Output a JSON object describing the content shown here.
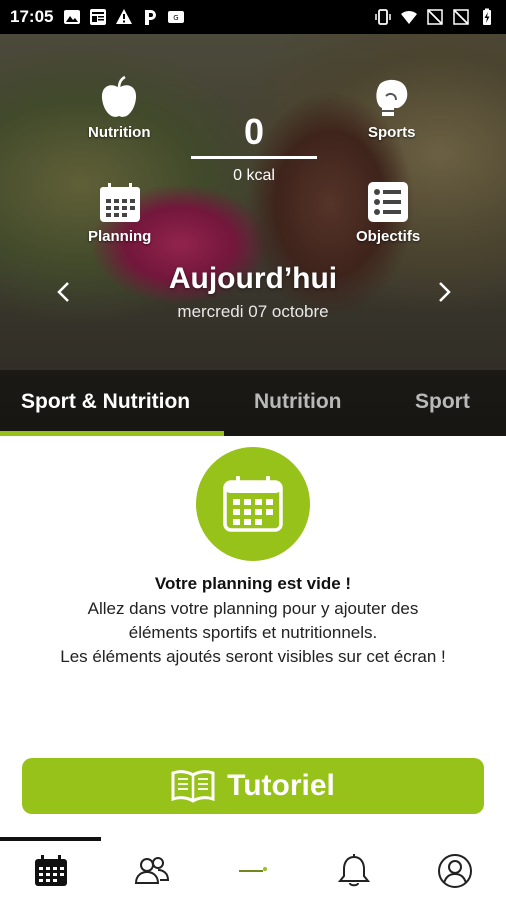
{
  "status_bar": {
    "time": "17:05",
    "left_icons": [
      "photo-icon",
      "news-icon",
      "warning-icon",
      "parking-icon",
      "message-icon"
    ],
    "right_icons": [
      "vibrate-icon",
      "wifi-icon",
      "signal-off-icon",
      "signal-off-icon",
      "battery-charging-icon"
    ]
  },
  "hero": {
    "nutrition_label": "Nutrition",
    "sports_label": "Sports",
    "planning_label": "Planning",
    "objectives_label": "Objectifs",
    "calories_value": "0",
    "calories_unit": "0 kcal",
    "date_title": "Aujourd’hui",
    "date_subtitle": "mercredi 07 octobre"
  },
  "tabs": [
    {
      "label": "Sport & Nutrition",
      "active": true
    },
    {
      "label": "Nutrition",
      "active": false
    },
    {
      "label": "Sport",
      "active": false
    }
  ],
  "empty_state": {
    "title": "Votre planning est vide !",
    "line1": "Allez dans votre planning pour y ajouter des",
    "line2": "éléments sportifs et nutritionnels.",
    "line3": "Les éléments ajoutés seront visibles sur cet écran !"
  },
  "tutorial_button": {
    "label": "Tutoriel",
    "icon": "open-book-icon"
  },
  "bottom_nav": [
    {
      "name": "calendar-icon",
      "active": true
    },
    {
      "name": "community-icon",
      "active": false
    },
    {
      "name": "brand-logo",
      "active": false
    },
    {
      "name": "bell-icon",
      "active": false
    },
    {
      "name": "profile-icon",
      "active": false
    }
  ],
  "colors": {
    "accent_green": "#97c21a",
    "status_bar_bg": "#000000",
    "tab_inactive": "#b9b9b9"
  }
}
